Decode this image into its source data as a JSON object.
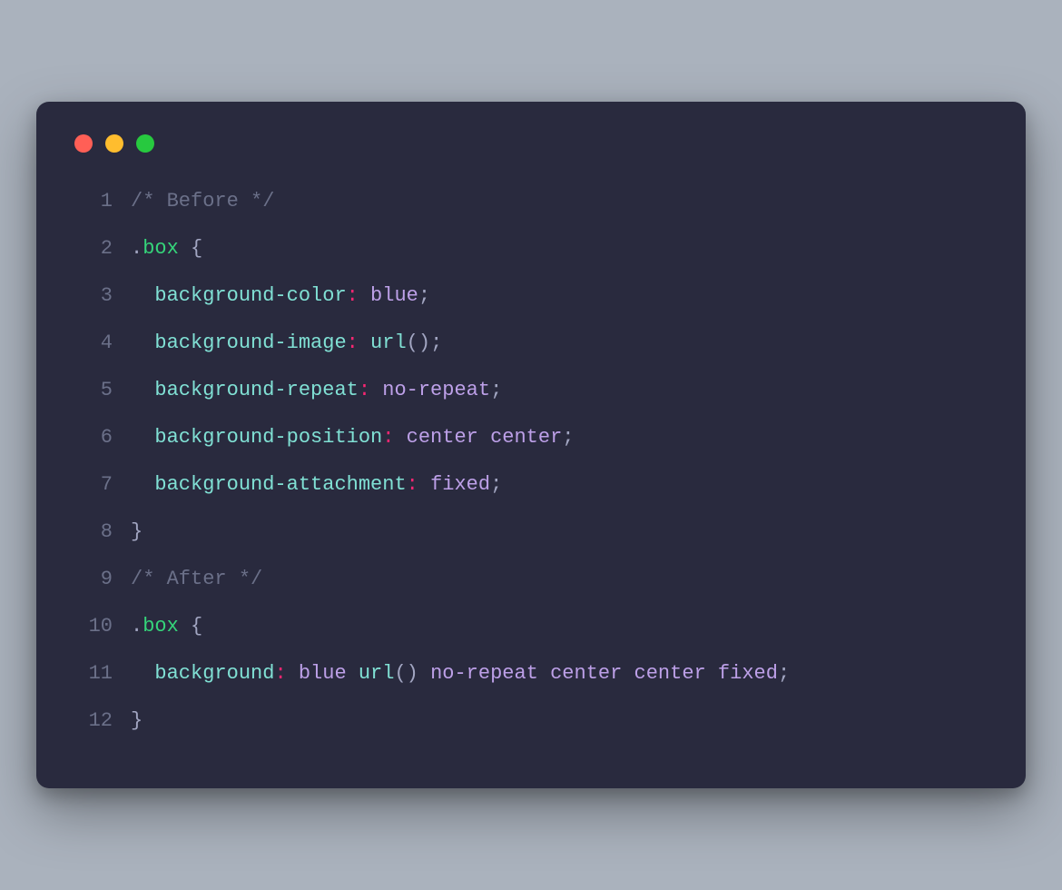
{
  "code": {
    "lines": [
      {
        "n": "1",
        "tokens": [
          {
            "t": "/* Before */",
            "c": "c-comment"
          }
        ]
      },
      {
        "n": "2",
        "tokens": [
          {
            "t": ".",
            "c": "c-punct"
          },
          {
            "t": "box",
            "c": "c-selclass"
          },
          {
            "t": " {",
            "c": "c-punct"
          }
        ]
      },
      {
        "n": "3",
        "tokens": [
          {
            "t": "  ",
            "c": ""
          },
          {
            "t": "background-color",
            "c": "c-prop"
          },
          {
            "t": ":",
            "c": "c-colon"
          },
          {
            "t": " ",
            "c": ""
          },
          {
            "t": "blue",
            "c": "c-value"
          },
          {
            "t": ";",
            "c": "c-punct"
          }
        ]
      },
      {
        "n": "4",
        "tokens": [
          {
            "t": "  ",
            "c": ""
          },
          {
            "t": "background-image",
            "c": "c-prop"
          },
          {
            "t": ":",
            "c": "c-colon"
          },
          {
            "t": " ",
            "c": ""
          },
          {
            "t": "url",
            "c": "c-func"
          },
          {
            "t": "()",
            "c": "c-punct"
          },
          {
            "t": ";",
            "c": "c-punct"
          }
        ]
      },
      {
        "n": "5",
        "tokens": [
          {
            "t": "  ",
            "c": ""
          },
          {
            "t": "background-repeat",
            "c": "c-prop"
          },
          {
            "t": ":",
            "c": "c-colon"
          },
          {
            "t": " ",
            "c": ""
          },
          {
            "t": "no-repeat",
            "c": "c-value"
          },
          {
            "t": ";",
            "c": "c-punct"
          }
        ]
      },
      {
        "n": "6",
        "tokens": [
          {
            "t": "  ",
            "c": ""
          },
          {
            "t": "background-position",
            "c": "c-prop"
          },
          {
            "t": ":",
            "c": "c-colon"
          },
          {
            "t": " ",
            "c": ""
          },
          {
            "t": "center center",
            "c": "c-value"
          },
          {
            "t": ";",
            "c": "c-punct"
          }
        ]
      },
      {
        "n": "7",
        "tokens": [
          {
            "t": "  ",
            "c": ""
          },
          {
            "t": "background-attachment",
            "c": "c-prop"
          },
          {
            "t": ":",
            "c": "c-colon"
          },
          {
            "t": " ",
            "c": ""
          },
          {
            "t": "fixed",
            "c": "c-value"
          },
          {
            "t": ";",
            "c": "c-punct"
          }
        ]
      },
      {
        "n": "8",
        "tokens": [
          {
            "t": "}",
            "c": "c-punct"
          }
        ]
      },
      {
        "n": "9",
        "tokens": [
          {
            "t": "/* After */",
            "c": "c-comment"
          }
        ]
      },
      {
        "n": "10",
        "tokens": [
          {
            "t": ".",
            "c": "c-punct"
          },
          {
            "t": "box",
            "c": "c-selclass"
          },
          {
            "t": " {",
            "c": "c-punct"
          }
        ]
      },
      {
        "n": "11",
        "tokens": [
          {
            "t": "  ",
            "c": ""
          },
          {
            "t": "background",
            "c": "c-prop"
          },
          {
            "t": ":",
            "c": "c-colon"
          },
          {
            "t": " ",
            "c": ""
          },
          {
            "t": "blue",
            "c": "c-value"
          },
          {
            "t": " ",
            "c": ""
          },
          {
            "t": "url",
            "c": "c-func"
          },
          {
            "t": "()",
            "c": "c-punct"
          },
          {
            "t": " ",
            "c": ""
          },
          {
            "t": "no-repeat center center fixed",
            "c": "c-value"
          },
          {
            "t": ";",
            "c": "c-punct"
          }
        ]
      },
      {
        "n": "12",
        "tokens": [
          {
            "t": "}",
            "c": "c-punct"
          }
        ]
      }
    ]
  }
}
